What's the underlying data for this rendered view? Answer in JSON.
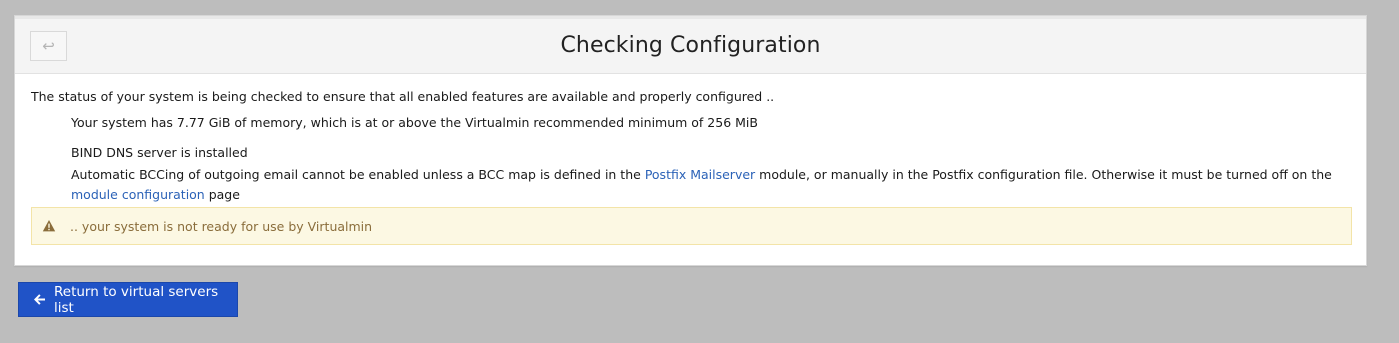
{
  "header": {
    "title": "Checking Configuration",
    "back_icon": "↩"
  },
  "content": {
    "intro": "The status of your system is being checked to ensure that all enabled features are available and properly configured ..",
    "checks": [
      "Your system has 7.77 GiB of memory, which is at or above the Virtualmin recommended minimum of 256 MiB",
      "BIND DNS server is installed"
    ],
    "bcc": {
      "before": "Automatic BCCing of outgoing email cannot be enabled unless a BCC map is defined in the ",
      "link1": "Postfix Mailserver",
      "middle": " module, or manually in the Postfix configuration file. Otherwise it must be turned off on the ",
      "link2": "module configuration",
      "after": " page"
    }
  },
  "alert": {
    "text": ".. your system is not ready for use by Virtualmin",
    "icon": "warning-icon",
    "color": "#8a6d3b",
    "background": "#fcf8e3"
  },
  "footer": {
    "return_label": "Return to virtual servers list",
    "return_icon": "arrow-left-icon",
    "button_color": "#2053c7"
  }
}
